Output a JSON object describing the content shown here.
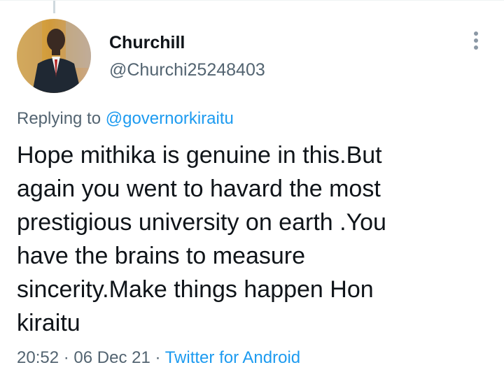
{
  "tweet": {
    "author": {
      "name": "Churchill",
      "handle": "@Churchi25248403",
      "avatar_icon": "profile-photo"
    },
    "replying_prefix": "Replying to",
    "replying_to": "@governorkiraitu",
    "text": "Hope mithika is genuine in this.But\nagain you went to havard the most\nprestigious university on  earth .You\nhave the brains to measure\nsincerity.Make things happen Hon\nkiraitu",
    "time": "20:52",
    "separator": "·",
    "date": "06 Dec 21",
    "source": "Twitter for Android"
  },
  "colors": {
    "accent": "#1d9bf0",
    "text_primary": "#0f1419",
    "text_secondary": "#536471",
    "thread_line": "#cfd9de"
  },
  "icons": {
    "more": "more-vertical-icon"
  }
}
